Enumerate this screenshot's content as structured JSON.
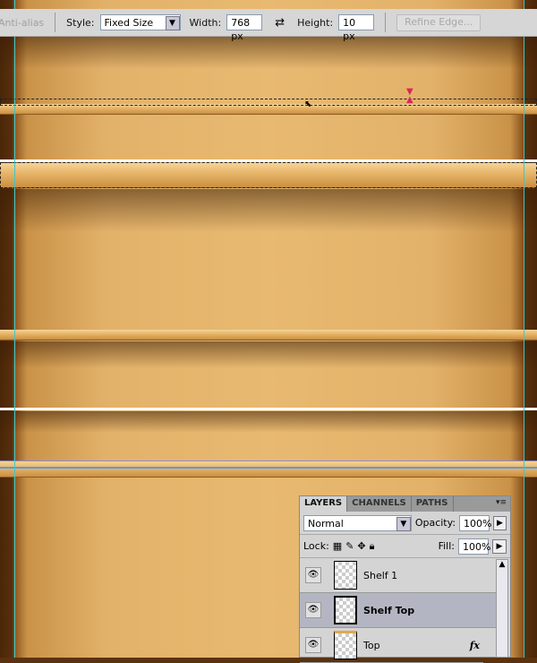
{
  "options_bar": {
    "anti_alias": "Anti-alias",
    "style_label": "Style:",
    "style_value": "Fixed Size",
    "width_label": "Width:",
    "width_value": "768 px",
    "height_label": "Height:",
    "height_value": "10 px",
    "refine_edge": "Refine Edge..."
  },
  "layers_panel": {
    "tabs": [
      "LAYERS",
      "CHANNELS",
      "PATHS"
    ],
    "blend_mode": "Normal",
    "opacity_label": "Opacity:",
    "opacity_value": "100%",
    "lock_label": "Lock:",
    "fill_label": "Fill:",
    "fill_value": "100%",
    "layers": [
      {
        "name": "Shelf 1",
        "selected": false
      },
      {
        "name": "Shelf Top",
        "selected": true
      },
      {
        "name": "Top",
        "selected": false,
        "fx": "fx"
      }
    ]
  },
  "colors": {
    "guide": "#3fc8c8",
    "selected_layer": "#b3b6c2",
    "wood": "#e8b970"
  }
}
